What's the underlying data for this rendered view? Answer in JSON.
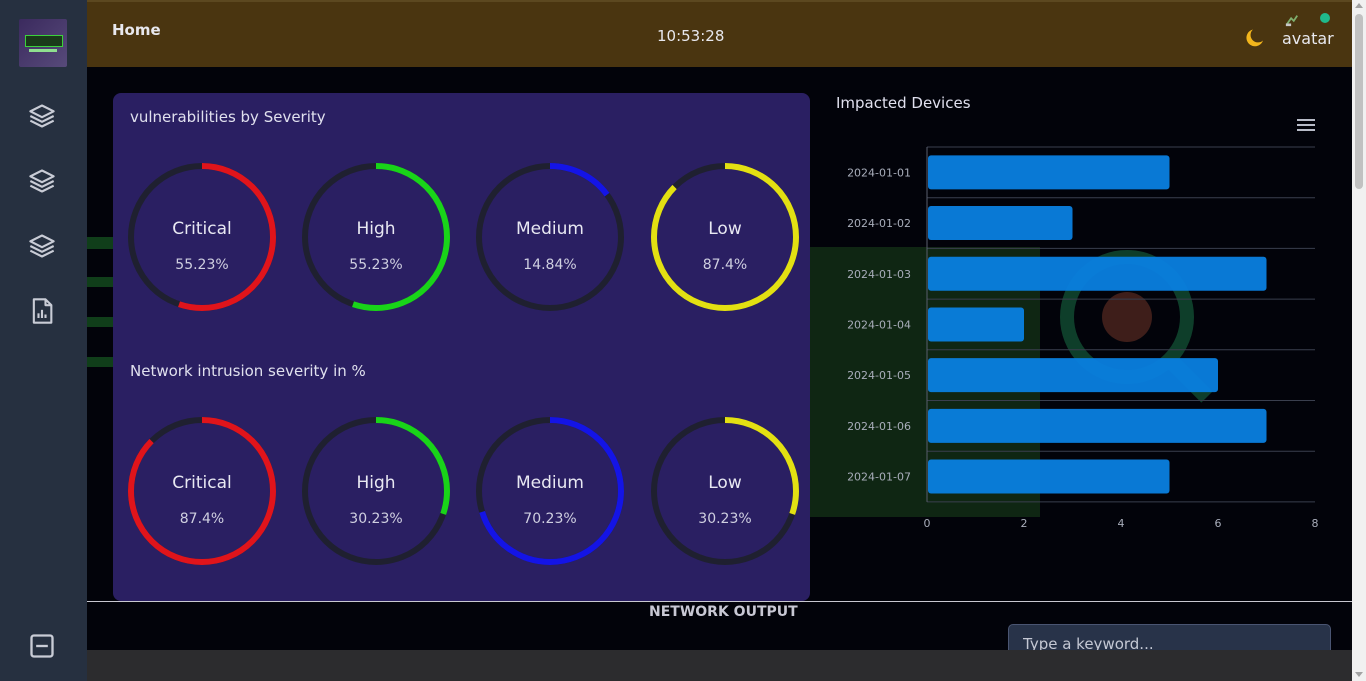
{
  "header": {
    "title": "Home",
    "clock": "10:53:28",
    "avatar_label": "avatar",
    "icons": [
      "moon-icon",
      "broken-image-icon",
      "status-dot"
    ]
  },
  "sidebar": {
    "items": [
      {
        "name": "layers-icon-1"
      },
      {
        "name": "layers-icon-2"
      },
      {
        "name": "layers-icon-3"
      },
      {
        "name": "report-icon"
      }
    ],
    "bottom_icon": "panel-icon"
  },
  "vulnerabilities": {
    "title": "vulnerabilities by Severity",
    "gauges": [
      {
        "label": "Critical",
        "value": "55.23%",
        "percent": 55.23,
        "color": "#e0141b"
      },
      {
        "label": "High",
        "value": "55.23%",
        "percent": 55.23,
        "color": "#19d419"
      },
      {
        "label": "Medium",
        "value": "14.84%",
        "percent": 14.84,
        "color": "#1414e6"
      },
      {
        "label": "Low",
        "value": "87.4%",
        "percent": 87.4,
        "color": "#e3e012"
      }
    ]
  },
  "intrusion": {
    "title": "Network intrusion severity in %",
    "gauges": [
      {
        "label": "Critical",
        "value": "87.4%",
        "percent": 87.4,
        "color": "#e0141b"
      },
      {
        "label": "High",
        "value": "30.23%",
        "percent": 30.23,
        "color": "#19d419"
      },
      {
        "label": "Medium",
        "value": "70.23%",
        "percent": 70.23,
        "color": "#1414e6"
      },
      {
        "label": "Low",
        "value": "30.23%",
        "percent": 30.23,
        "color": "#e3e012"
      }
    ]
  },
  "chart_data": {
    "type": "bar",
    "orientation": "horizontal",
    "title": "Impacted Devices",
    "categories": [
      "2024-01-01",
      "2024-01-02",
      "2024-01-03",
      "2024-01-04",
      "2024-01-05",
      "2024-01-06",
      "2024-01-07"
    ],
    "values": [
      5,
      3,
      7,
      2,
      6,
      7,
      5
    ],
    "xlim": [
      0,
      8
    ],
    "xticks": [
      "0",
      "2",
      "4",
      "6",
      "8"
    ],
    "grid": true,
    "color": "#0a7fe0"
  },
  "footer": {
    "output_title": "NETWORK OUTPUT",
    "search_placeholder": "Type a keyword..."
  }
}
